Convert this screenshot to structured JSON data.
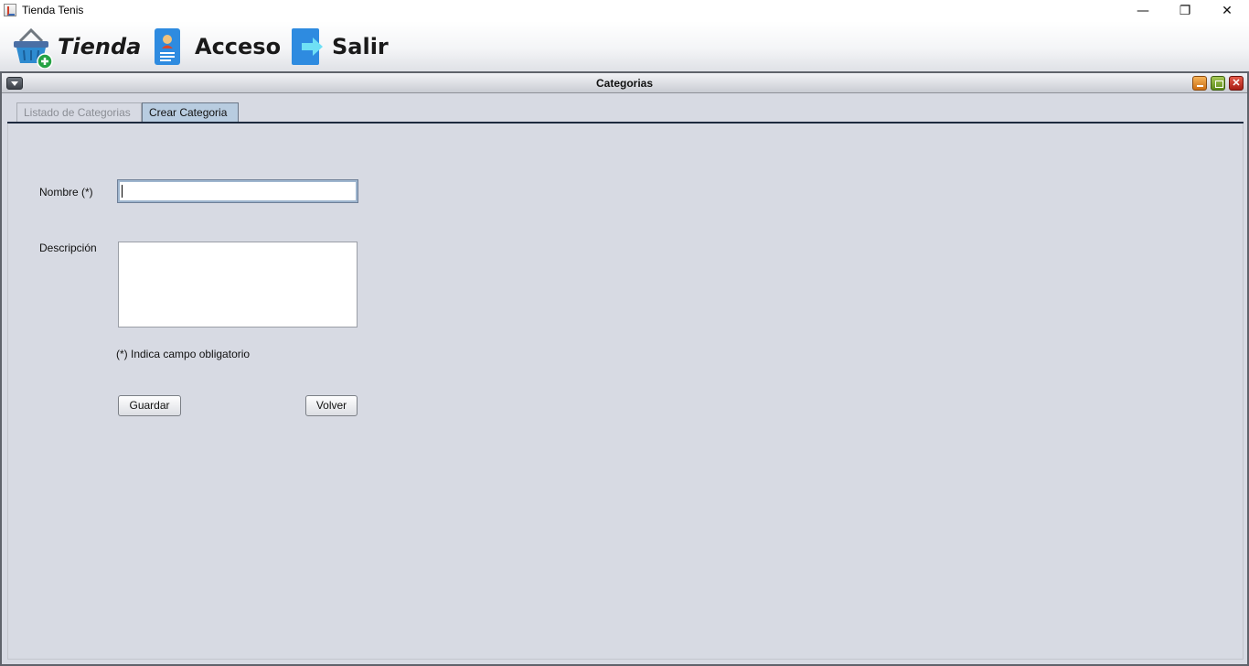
{
  "window": {
    "title": "Tienda Tenis",
    "minimize": "—",
    "restore": "❐",
    "close": "✕"
  },
  "menubar": {
    "items": [
      {
        "label": "Tienda",
        "icon": "basket-add-icon"
      },
      {
        "label": "Acceso",
        "icon": "id-badge-icon"
      },
      {
        "label": "Salir",
        "icon": "exit-arrow-icon"
      }
    ]
  },
  "internal_frame": {
    "title": "Categorias",
    "close_glyph": "✕"
  },
  "tabs": [
    {
      "label": "Listado de Categorias",
      "enabled": false
    },
    {
      "label": "Crear Categoria",
      "selected": true
    }
  ],
  "form": {
    "name_label": "Nombre (*)",
    "name_value": "",
    "description_label": "Descripción",
    "description_value": "",
    "required_note": "(*) Indica campo obligatorio",
    "save_label": "Guardar",
    "back_label": "Volver"
  },
  "colors": {
    "panel_bg": "#d7dae3",
    "selected_tab": "#b8cce0"
  }
}
